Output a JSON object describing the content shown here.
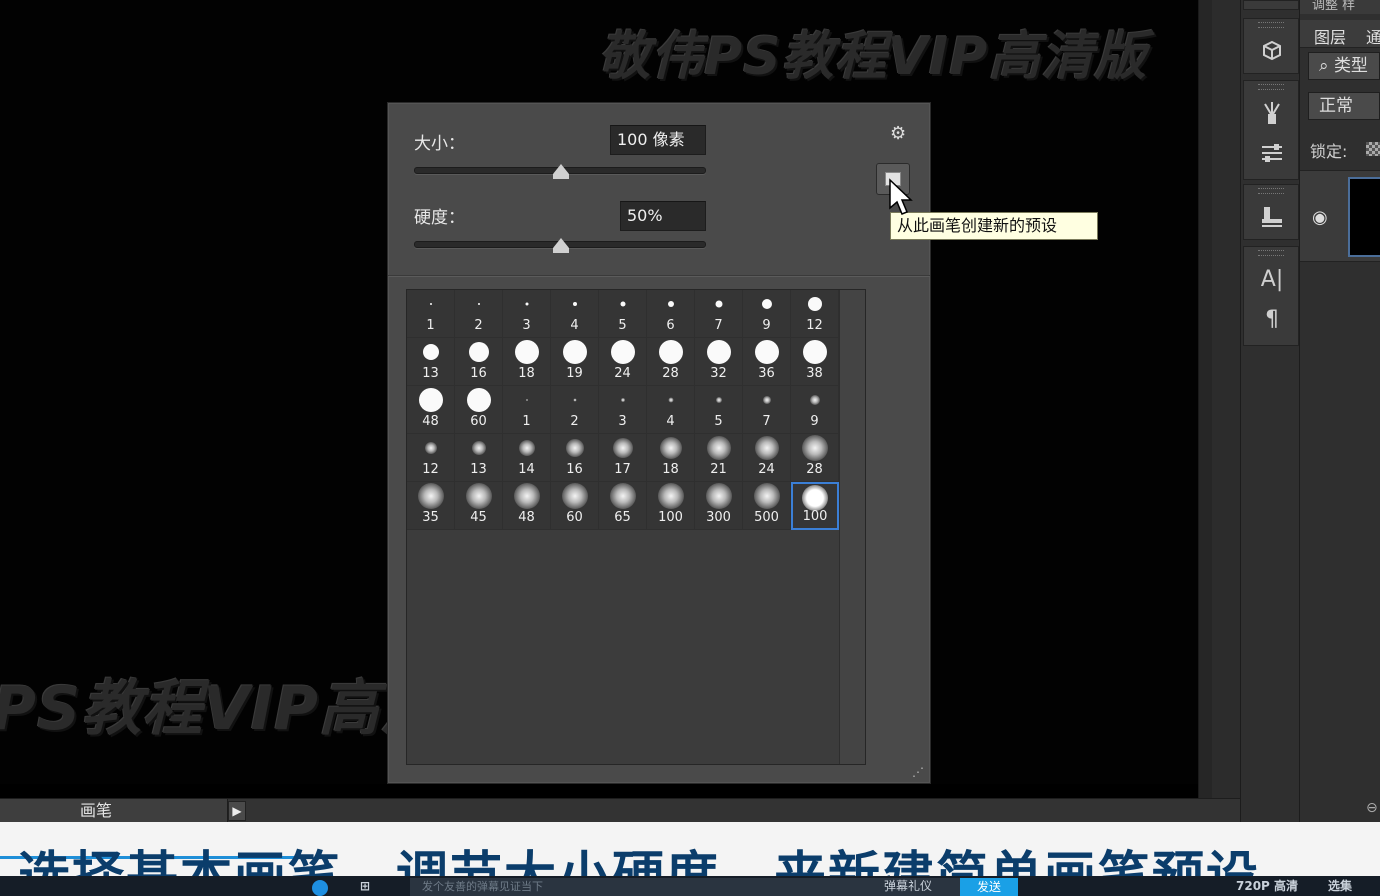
{
  "watermark": {
    "top_text": "敬伟PS教程VIP高清版",
    "bottom_text": "PS教程VIP高清版"
  },
  "brush_picker": {
    "size_label": "大小：",
    "size_value": "100 像素",
    "size_slider_level": 0.5,
    "hardness_label": "硬度：",
    "hardness_value": "50%",
    "hardness_slider_level": 0.5,
    "gear_icon": "gear-icon",
    "new_preset_icon": "new-preset-icon",
    "tooltip": "从此画笔创建新的预设",
    "brushes": [
      {
        "num": "1",
        "type": "hard",
        "d": 2
      },
      {
        "num": "2",
        "type": "hard",
        "d": 2
      },
      {
        "num": "3",
        "type": "hard",
        "d": 3
      },
      {
        "num": "4",
        "type": "hard",
        "d": 4
      },
      {
        "num": "5",
        "type": "hard",
        "d": 5
      },
      {
        "num": "6",
        "type": "hard",
        "d": 6
      },
      {
        "num": "7",
        "type": "hard",
        "d": 7
      },
      {
        "num": "9",
        "type": "hard",
        "d": 10
      },
      {
        "num": "12",
        "type": "hard",
        "d": 14
      },
      {
        "num": "13",
        "type": "hard",
        "d": 16
      },
      {
        "num": "16",
        "type": "hard",
        "d": 20
      },
      {
        "num": "18",
        "type": "hard",
        "d": 24
      },
      {
        "num": "19",
        "type": "hard",
        "d": 24
      },
      {
        "num": "24",
        "type": "hard",
        "d": 24
      },
      {
        "num": "28",
        "type": "hard",
        "d": 24
      },
      {
        "num": "32",
        "type": "hard",
        "d": 24
      },
      {
        "num": "36",
        "type": "hard",
        "d": 24
      },
      {
        "num": "38",
        "type": "hard",
        "d": 24
      },
      {
        "num": "48",
        "type": "hard",
        "d": 24
      },
      {
        "num": "60",
        "type": "hard",
        "d": 24
      },
      {
        "num": "1",
        "type": "soft",
        "d": 2
      },
      {
        "num": "2",
        "type": "soft",
        "d": 3
      },
      {
        "num": "3",
        "type": "soft",
        "d": 4
      },
      {
        "num": "4",
        "type": "soft",
        "d": 5
      },
      {
        "num": "5",
        "type": "soft",
        "d": 6
      },
      {
        "num": "7",
        "type": "soft",
        "d": 8
      },
      {
        "num": "9",
        "type": "soft",
        "d": 10
      },
      {
        "num": "12",
        "type": "soft",
        "d": 12
      },
      {
        "num": "13",
        "type": "soft",
        "d": 14
      },
      {
        "num": "14",
        "type": "soft",
        "d": 16
      },
      {
        "num": "16",
        "type": "soft",
        "d": 18
      },
      {
        "num": "17",
        "type": "soft",
        "d": 20
      },
      {
        "num": "18",
        "type": "soft",
        "d": 22
      },
      {
        "num": "21",
        "type": "soft",
        "d": 24
      },
      {
        "num": "24",
        "type": "soft",
        "d": 24
      },
      {
        "num": "28",
        "type": "soft",
        "d": 26
      },
      {
        "num": "35",
        "type": "soft",
        "d": 26
      },
      {
        "num": "45",
        "type": "soft",
        "d": 26
      },
      {
        "num": "48",
        "type": "soft",
        "d": 26
      },
      {
        "num": "60",
        "type": "soft",
        "d": 26
      },
      {
        "num": "65",
        "type": "soft",
        "d": 26
      },
      {
        "num": "100",
        "type": "soft",
        "d": 26
      },
      {
        "num": "300",
        "type": "soft",
        "d": 26
      },
      {
        "num": "500",
        "type": "soft",
        "d": 26
      },
      {
        "num": "100",
        "type": "medium",
        "d": 26,
        "selected": true
      }
    ]
  },
  "bottom_tab": {
    "label": "画笔",
    "play_icon": "play-icon"
  },
  "right_panel": {
    "top_tabs": "调整  样",
    "tab_layers": "图层",
    "tab_channels": "通",
    "filter_label": "类型",
    "blend_mode": "正常",
    "lock_label": "锁定:"
  },
  "toolstrip_icons": [
    "3d-icon",
    "brush-preset-icon",
    "adjust-icon",
    "clone-stamp-icon",
    "character-icon",
    "paragraph-icon"
  ],
  "subtitle": "选择基本画笔、调节大小硬度、来新建简单画笔预设",
  "player_bar": {
    "input_placeholder": "发个友善的弹幕见证当下",
    "etiquette": "弹幕礼仪",
    "send": "发送",
    "quality": "720P 高清",
    "episodes": "选集"
  },
  "colors": {
    "selection": "#3b7fd6",
    "tooltip_bg": "#ffffe1",
    "subtitle": "#0b3d6b",
    "send_button": "#1aa0e6"
  }
}
